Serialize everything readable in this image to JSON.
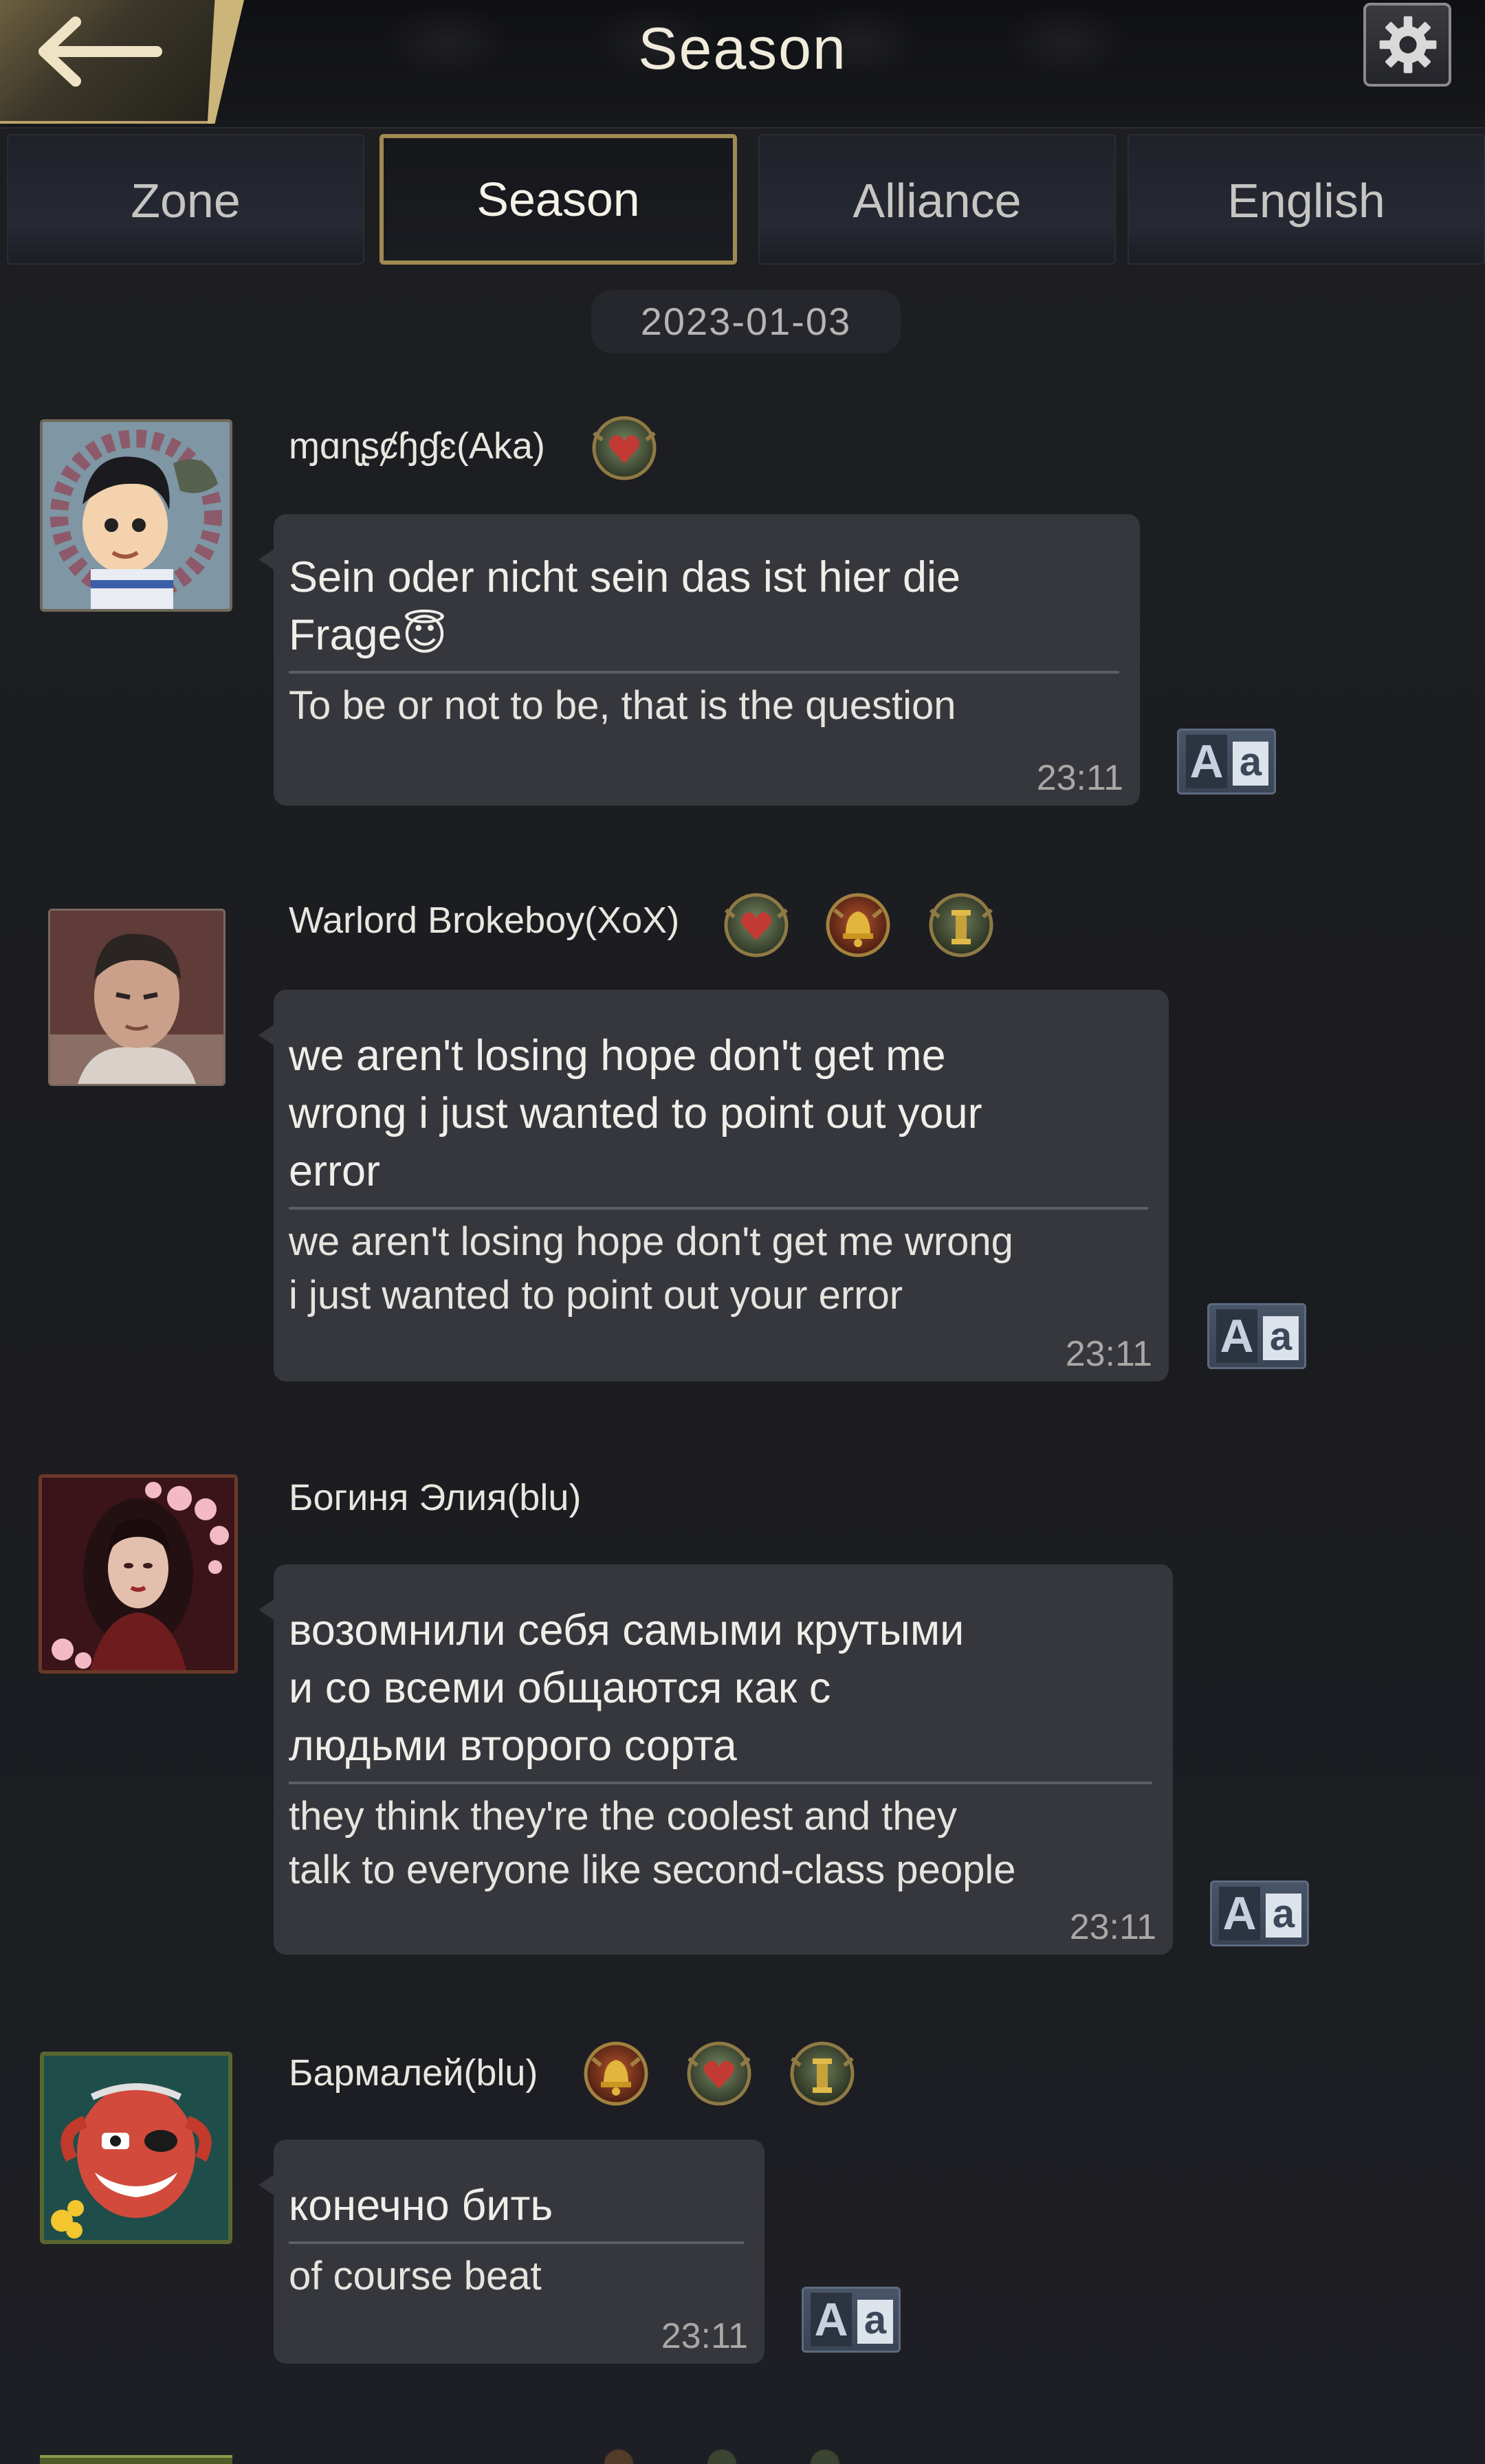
{
  "header": {
    "title": "Season"
  },
  "tabs": [
    {
      "label": "Zone",
      "active": false
    },
    {
      "label": "Season",
      "active": true
    },
    {
      "label": "Alliance",
      "active": false
    },
    {
      "label": "English",
      "active": false
    }
  ],
  "date": "2023-01-03",
  "translate_button": {
    "big": "A",
    "small": "a"
  },
  "messages": [
    {
      "username": "ɱɑɳʂȼɧɠɛ(Aka)",
      "badges": [
        "heart-badge-icon"
      ],
      "original": "Sein oder nicht sein das ist hier die\nFrage😇",
      "translation": "To be or not to be, that is the question",
      "time": "23:11"
    },
    {
      "username": "Warlord Brokeboy(XoX)",
      "badges": [
        "heart-badge-icon",
        "bell-badge-icon",
        "tower-badge-icon"
      ],
      "original": "we aren't losing hope don't get me\nwrong i just wanted to point out your\nerror",
      "translation": "we aren't losing hope don't get me wrong\n i just wanted to point out your error",
      "time": "23:11"
    },
    {
      "username": "Богиня Элия(blu)",
      "badges": [],
      "original": "возомнили себя самыми крутыми\nи со всеми общаются как с\nлюдьми второго сорта",
      "translation": "they think they're the coolest and they\ntalk to everyone like second-class people",
      "time": "23:11"
    },
    {
      "username": "Бармалей(blu)",
      "badges": [
        "bell-badge-icon",
        "heart-badge-icon",
        "tower-badge-icon"
      ],
      "original": "конечно бить",
      "translation": "of course beat",
      "time": "23:11"
    }
  ],
  "colors": {
    "background": "#1d1e22",
    "bubble": "#35373c",
    "active_tab_border": "#a08a52",
    "text": "#f0eee9",
    "translate_button": "#485467"
  }
}
